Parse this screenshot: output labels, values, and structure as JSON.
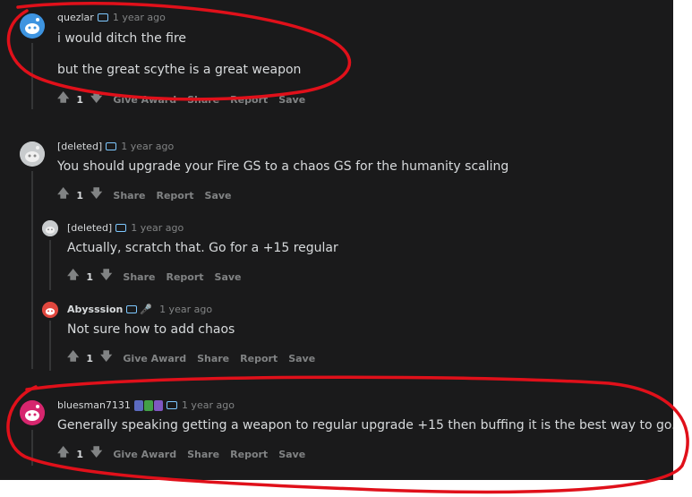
{
  "comments": [
    {
      "author": "quezlar",
      "time": "1 year ago",
      "lines": [
        "i would ditch the fire",
        "but the great scythe is a great weapon"
      ],
      "score": "1",
      "actions": [
        "Give Award",
        "Share",
        "Report",
        "Save"
      ]
    },
    {
      "author": "[deleted]",
      "time": "1 year ago",
      "lines": [
        "You should upgrade your Fire GS to a chaos GS for the humanity scaling"
      ],
      "score": "1",
      "actions": [
        "Share",
        "Report",
        "Save"
      ]
    },
    {
      "author": "[deleted]",
      "time": "1 year ago",
      "lines": [
        "Actually, scratch that. Go for a +15 regular"
      ],
      "score": "1",
      "actions": [
        "Share",
        "Report",
        "Save"
      ]
    },
    {
      "author": "Abysssion",
      "time": "1 year ago",
      "lines": [
        "Not sure how to add chaos"
      ],
      "score": "1",
      "actions": [
        "Give Award",
        "Share",
        "Report",
        "Save"
      ]
    },
    {
      "author": "bluesman7131",
      "time": "1 year ago",
      "lines": [
        "Generally speaking getting a weapon to regular upgrade +15 then buffing it is the best way to go."
      ],
      "score": "1",
      "actions": [
        "Give Award",
        "Share",
        "Report",
        "Save"
      ]
    }
  ],
  "colors": {
    "background": "#1a1a1b",
    "text": "#d7dadc",
    "muted": "#818384",
    "annotation": "#e0101a",
    "flair": "#7ec8ff"
  }
}
